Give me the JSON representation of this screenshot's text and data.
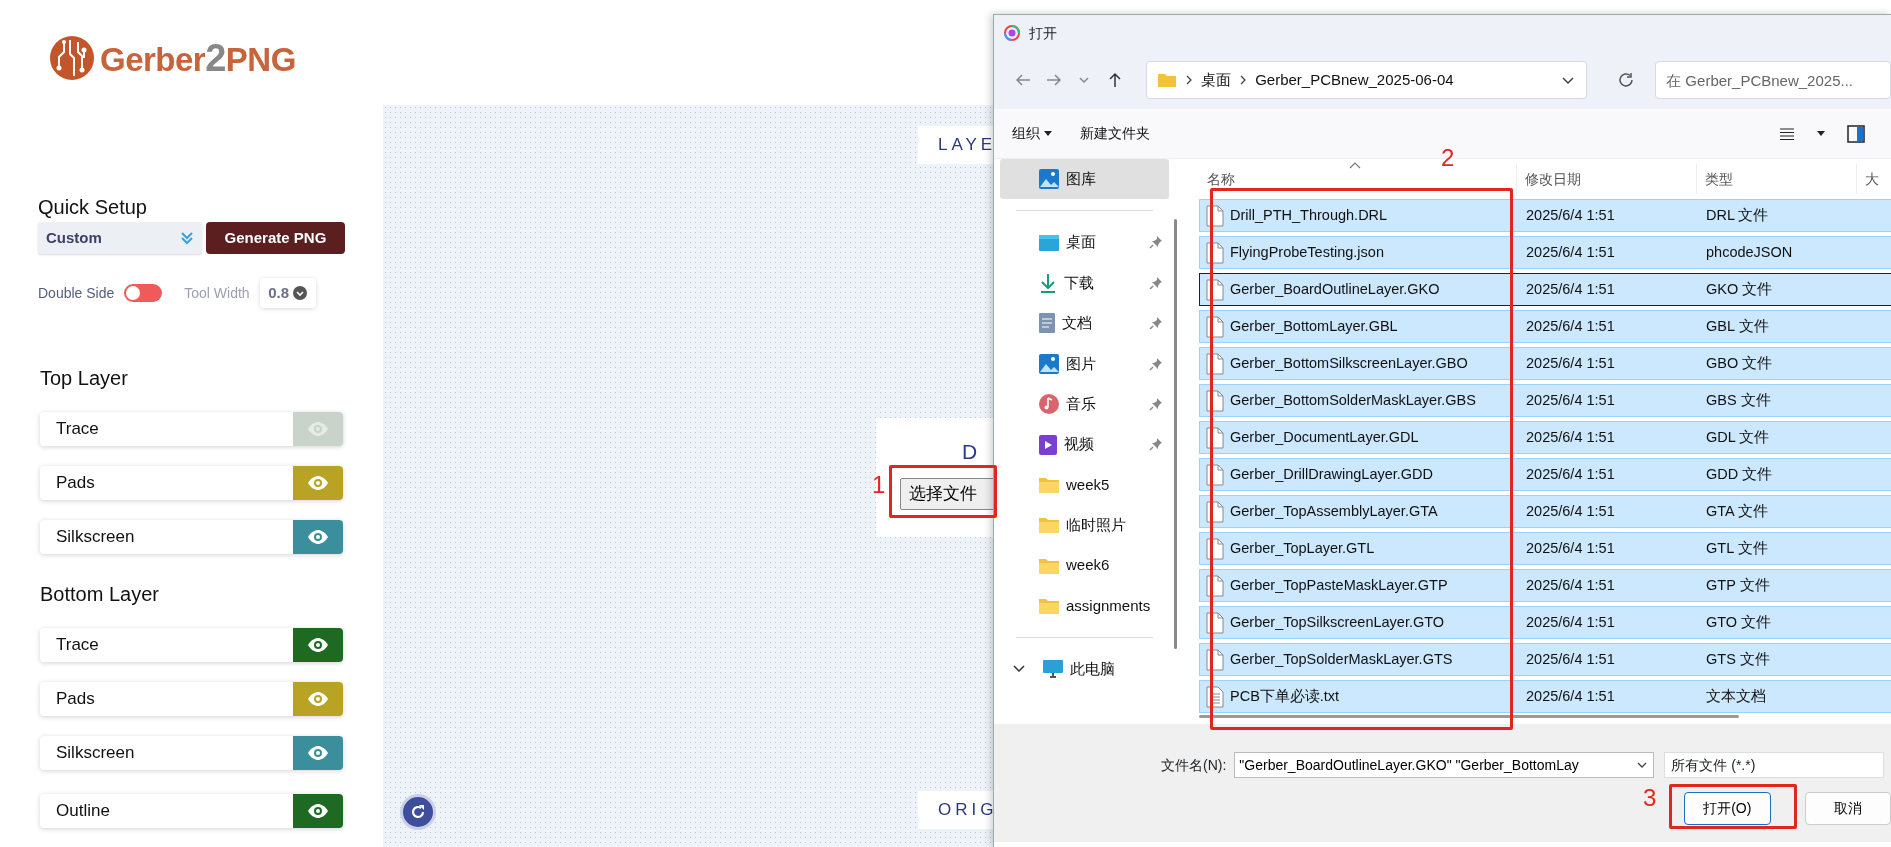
{
  "logo": {
    "text": "Gerber",
    "number": "2",
    "suffix": "PNG"
  },
  "quick_setup": {
    "title": "Quick Setup",
    "preset": "Custom",
    "generate_button": "Generate PNG"
  },
  "double_side": {
    "label": "Double Side",
    "on": false
  },
  "tool_width": {
    "label": "Tool Width",
    "value": "0.8"
  },
  "layer_groups": [
    {
      "title": "Top Layer",
      "layers": [
        {
          "name": "Trace",
          "visible": false,
          "color": "#c9d3ca"
        },
        {
          "name": "Pads",
          "visible": true,
          "color": "#b9a325"
        },
        {
          "name": "Silkscreen",
          "visible": true,
          "color": "#3b8f9c"
        }
      ]
    },
    {
      "title": "Bottom Layer",
      "layers": [
        {
          "name": "Trace",
          "visible": true,
          "color": "#1e6a22"
        },
        {
          "name": "Pads",
          "visible": true,
          "color": "#b9a325"
        },
        {
          "name": "Silkscreen",
          "visible": true,
          "color": "#3b8f9c"
        }
      ]
    },
    {
      "layers": [
        {
          "name": "Outline",
          "visible": true,
          "color": "#1e6a22"
        }
      ]
    }
  ],
  "canvas": {
    "top_label": "LAYE",
    "bottom_label": "ORIG",
    "upload_title": "D",
    "choose_file_button": "选择文件"
  },
  "dialog": {
    "title": "打开",
    "path": [
      "桌面",
      "Gerber_PCBnew_2025-06-04"
    ],
    "search": {
      "placeholder": "在 Gerber_PCBnew_2025..."
    },
    "toolbar": [
      "组织",
      "新建文件夹"
    ],
    "sidebar": [
      {
        "label": "图库",
        "kind": "gallery",
        "pinned": false,
        "selected": true
      },
      {
        "label": "桌面",
        "kind": "desktop",
        "pinned": true,
        "selected": false
      },
      {
        "label": "下载",
        "kind": "download",
        "pinned": true,
        "selected": false
      },
      {
        "label": "文档",
        "kind": "document",
        "pinned": true,
        "selected": false
      },
      {
        "label": "图片",
        "kind": "pictures",
        "pinned": true,
        "selected": false
      },
      {
        "label": "音乐",
        "kind": "music",
        "pinned": true,
        "selected": false
      },
      {
        "label": "视频",
        "kind": "video",
        "pinned": true,
        "selected": false
      },
      {
        "label": "week5",
        "kind": "folder",
        "pinned": false,
        "selected": false
      },
      {
        "label": "临时照片",
        "kind": "folder",
        "pinned": false,
        "selected": false
      },
      {
        "label": "week6",
        "kind": "folder",
        "pinned": false,
        "selected": false
      },
      {
        "label": "assignments",
        "kind": "folder",
        "pinned": false,
        "selected": false
      }
    ],
    "this_pc": {
      "label": "此电脑",
      "expanded": true
    },
    "columns": [
      "名称",
      "修改日期",
      "类型",
      "大"
    ],
    "files": [
      {
        "kind": "file",
        "name": "Drill_PTH_Through.DRL",
        "modified": "2025/6/4 1:51",
        "type": "DRL 文件",
        "selected": true,
        "focused": false
      },
      {
        "kind": "file",
        "name": "FlyingProbeTesting.json",
        "modified": "2025/6/4 1:51",
        "type": "phcodeJSON",
        "selected": true,
        "focused": false
      },
      {
        "kind": "file",
        "name": "Gerber_BoardOutlineLayer.GKO",
        "modified": "2025/6/4 1:51",
        "type": "GKO 文件",
        "selected": true,
        "focused": true
      },
      {
        "kind": "file",
        "name": "Gerber_BottomLayer.GBL",
        "modified": "2025/6/4 1:51",
        "type": "GBL 文件",
        "selected": true,
        "focused": false
      },
      {
        "kind": "file",
        "name": "Gerber_BottomSilkscreenLayer.GBO",
        "modified": "2025/6/4 1:51",
        "type": "GBO 文件",
        "selected": true,
        "focused": false
      },
      {
        "kind": "file",
        "name": "Gerber_BottomSolderMaskLayer.GBS",
        "modified": "2025/6/4 1:51",
        "type": "GBS 文件",
        "selected": true,
        "focused": false
      },
      {
        "kind": "file",
        "name": "Gerber_DocumentLayer.GDL",
        "modified": "2025/6/4 1:51",
        "type": "GDL 文件",
        "selected": true,
        "focused": false
      },
      {
        "kind": "file",
        "name": "Gerber_DrillDrawingLayer.GDD",
        "modified": "2025/6/4 1:51",
        "type": "GDD 文件",
        "selected": true,
        "focused": false
      },
      {
        "kind": "file",
        "name": "Gerber_TopAssemblyLayer.GTA",
        "modified": "2025/6/4 1:51",
        "type": "GTA 文件",
        "selected": true,
        "focused": false
      },
      {
        "kind": "file",
        "name": "Gerber_TopLayer.GTL",
        "modified": "2025/6/4 1:51",
        "type": "GTL 文件",
        "selected": true,
        "focused": false
      },
      {
        "kind": "file",
        "name": "Gerber_TopPasteMaskLayer.GTP",
        "modified": "2025/6/4 1:51",
        "type": "GTP 文件",
        "selected": true,
        "focused": false
      },
      {
        "kind": "file",
        "name": "Gerber_TopSilkscreenLayer.GTO",
        "modified": "2025/6/4 1:51",
        "type": "GTO 文件",
        "selected": true,
        "focused": false
      },
      {
        "kind": "file",
        "name": "Gerber_TopSolderMaskLayer.GTS",
        "modified": "2025/6/4 1:51",
        "type": "GTS 文件",
        "selected": true,
        "focused": false
      },
      {
        "kind": "text",
        "name": "PCB下单必读.txt",
        "modified": "2025/6/4 1:51",
        "type": "文本文档",
        "selected": true,
        "focused": false
      }
    ],
    "filename_label": "文件名(N):",
    "filename_value": "\"Gerber_BoardOutlineLayer.GKO\" \"Gerber_BottomLay",
    "filter": "所有文件 (*.*)",
    "open_button": "打开(O)",
    "cancel_button": "取消"
  },
  "annotations": [
    {
      "number": "1"
    },
    {
      "number": "2"
    },
    {
      "number": "3"
    }
  ]
}
